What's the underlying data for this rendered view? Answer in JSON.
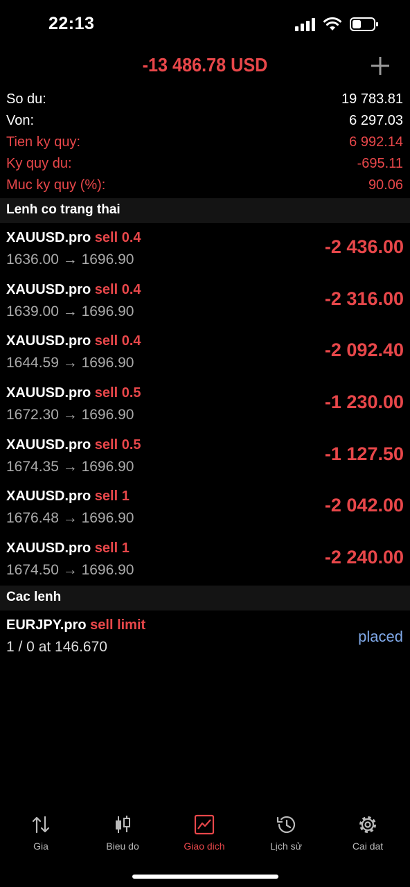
{
  "status_bar": {
    "time": "22:13"
  },
  "header": {
    "total_pl": "-13 486.78 USD"
  },
  "summary": [
    {
      "label": "So du:",
      "value": "19 783.81",
      "highlight": false
    },
    {
      "label": "Von:",
      "value": "6 297.03",
      "highlight": false
    },
    {
      "label": "Tien ky quy:",
      "value": "6 992.14",
      "highlight": true
    },
    {
      "label": "Ky quy du:",
      "value": "-695.11",
      "highlight": true
    },
    {
      "label": "Muc ky quy (%):",
      "value": "90.06",
      "highlight": true
    }
  ],
  "open_positions": {
    "title": "Lenh co trang thai",
    "items": [
      {
        "symbol": "XAUUSD.pro",
        "side": "sell 0.4",
        "prices": "1636.00 → 1696.90",
        "pl": "-2 436.00"
      },
      {
        "symbol": "XAUUSD.pro",
        "side": "sell 0.4",
        "prices": "1639.00 → 1696.90",
        "pl": "-2 316.00"
      },
      {
        "symbol": "XAUUSD.pro",
        "side": "sell 0.4",
        "prices": "1644.59 → 1696.90",
        "pl": "-2 092.40"
      },
      {
        "symbol": "XAUUSD.pro",
        "side": "sell 0.5",
        "prices": "1672.30 → 1696.90",
        "pl": "-1 230.00"
      },
      {
        "symbol": "XAUUSD.pro",
        "side": "sell 0.5",
        "prices": "1674.35 → 1696.90",
        "pl": "-1 127.50"
      },
      {
        "symbol": "XAUUSD.pro",
        "side": "sell 1",
        "prices": "1676.48 → 1696.90",
        "pl": "-2 042.00"
      },
      {
        "symbol": "XAUUSD.pro",
        "side": "sell 1",
        "prices": "1674.50 → 1696.90",
        "pl": "-2 240.00"
      }
    ]
  },
  "pending_orders": {
    "title": "Cac lenh",
    "items": [
      {
        "symbol": "EURJPY.pro",
        "side": "sell limit",
        "details": "1 / 0 at 146.670",
        "status": "placed"
      }
    ]
  },
  "tabs": [
    {
      "label": "Gia",
      "icon": "arrows-up-down-icon",
      "active": false
    },
    {
      "label": "Bieu do",
      "icon": "candlestick-icon",
      "active": false
    },
    {
      "label": "Giao dich",
      "icon": "trade-chart-icon",
      "active": true
    },
    {
      "label": "Lịch sử",
      "icon": "history-icon",
      "active": false
    },
    {
      "label": "Cai dat",
      "icon": "gear-icon",
      "active": false
    }
  ],
  "colors": {
    "accent": "#e8474a",
    "placed": "#7fa8e8",
    "background": "#000000"
  }
}
